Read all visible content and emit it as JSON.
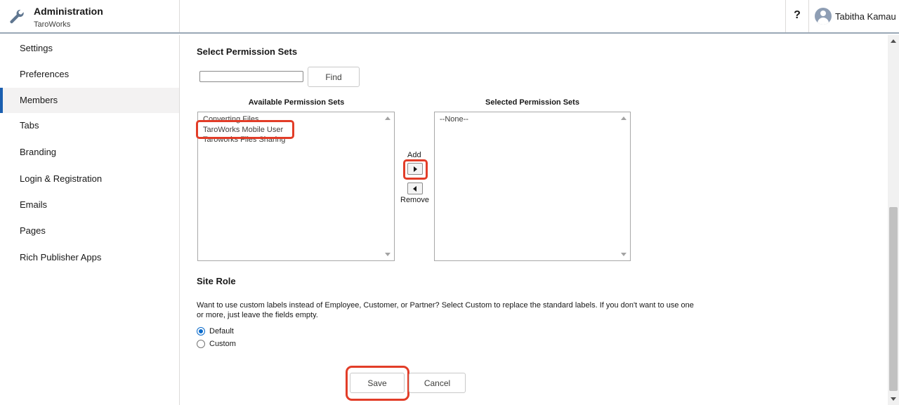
{
  "header": {
    "title": "Administration",
    "subtitle": "TaroWorks",
    "help_label": "?",
    "user_name": "Tabitha Kamau"
  },
  "sidebar": {
    "active": "Members",
    "items": [
      {
        "label": "Settings"
      },
      {
        "label": "Preferences"
      },
      {
        "label": "Members"
      },
      {
        "label": "Tabs"
      },
      {
        "label": "Branding"
      },
      {
        "label": "Login & Registration"
      },
      {
        "label": "Emails"
      },
      {
        "label": "Pages"
      },
      {
        "label": "Rich Publisher Apps"
      }
    ]
  },
  "permission_sets": {
    "heading": "Select Permission Sets",
    "search_value": "",
    "find_label": "Find",
    "available_label": "Available Permission Sets",
    "selected_label": "Selected Permission Sets",
    "available_items": [
      "Converting Files",
      "TaroWorks Mobile User",
      "Taroworks Files Sharing"
    ],
    "highlighted_item": "TaroWorks Mobile User",
    "selected_items": [
      "--None--"
    ],
    "add_label": "Add",
    "remove_label": "Remove"
  },
  "site_role": {
    "heading": "Site Role",
    "description": "Want to use custom labels instead of Employee, Customer, or Partner? Select Custom to replace the standard labels. If you don't want to use one or more, just leave the fields empty.",
    "options": [
      {
        "label": "Default",
        "checked": true
      },
      {
        "label": "Custom",
        "checked": false
      }
    ]
  },
  "actions": {
    "save_label": "Save",
    "cancel_label": "Cancel"
  },
  "colors": {
    "highlight": "#e23d28",
    "accent": "#1b5fb0"
  }
}
